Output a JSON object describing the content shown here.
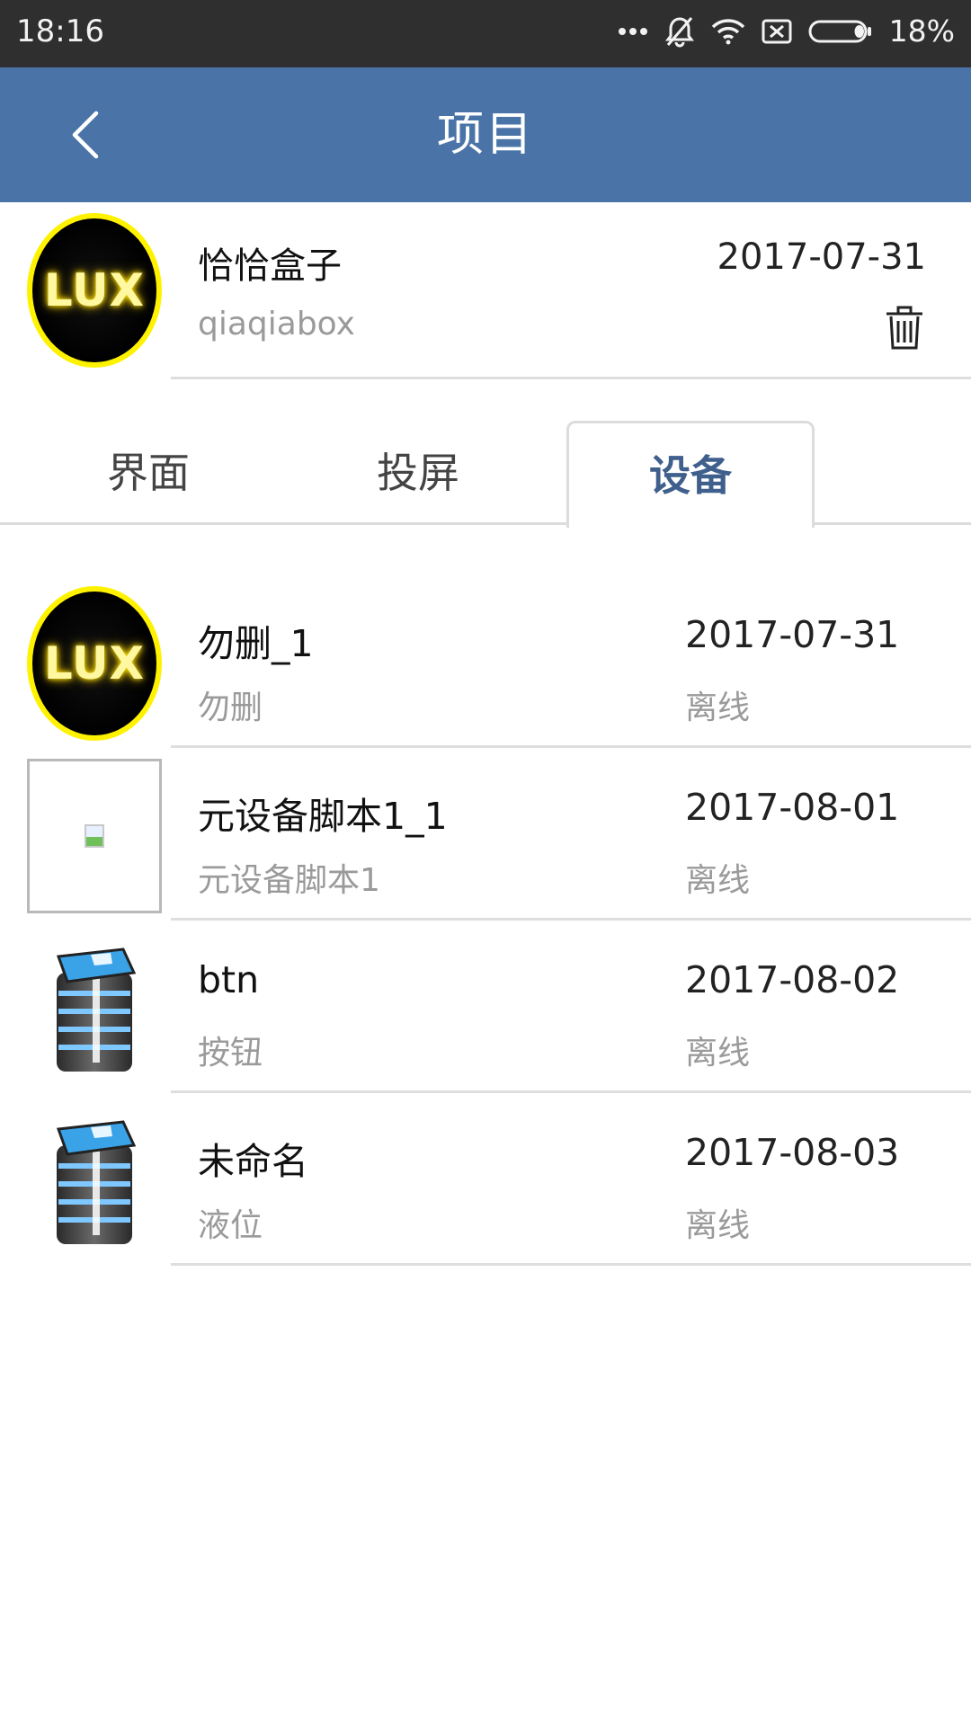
{
  "status_bar": {
    "time": "18:16",
    "battery_percent": "18%",
    "icons": [
      "more-dots-icon",
      "bell-off-icon",
      "wifi-icon",
      "sim-off-icon",
      "battery-icon"
    ],
    "battery_level": 0.18
  },
  "header": {
    "title": "项目",
    "back_icon": "chevron-left-icon",
    "background": "#4a74a7"
  },
  "project": {
    "name": "恰恰盒子",
    "subtitle": "qiaqiabox",
    "date": "2017-07-31",
    "avatar_text": "LUX",
    "delete_icon": "trash-icon"
  },
  "tabs": [
    {
      "label": "界面",
      "active": false
    },
    {
      "label": "投屏",
      "active": false
    },
    {
      "label": "设备",
      "active": true
    }
  ],
  "active_tab_color": "#3f5f8c",
  "devices": [
    {
      "name": "勿删_1",
      "subtitle": "勿删",
      "date": "2017-07-31",
      "status": "离线",
      "thumb": "lux-logo",
      "thumb_text": "LUX"
    },
    {
      "name": "元设备脚本1_1",
      "subtitle": "元设备脚本1",
      "date": "2017-08-01",
      "status": "离线",
      "thumb": "broken-image-icon"
    },
    {
      "name": "btn",
      "subtitle": "按钮",
      "date": "2017-08-02",
      "status": "离线",
      "thumb": "server-stack-icon"
    },
    {
      "name": "未命名",
      "subtitle": "液位",
      "date": "2017-08-03",
      "status": "离线",
      "thumb": "server-stack-icon"
    }
  ]
}
